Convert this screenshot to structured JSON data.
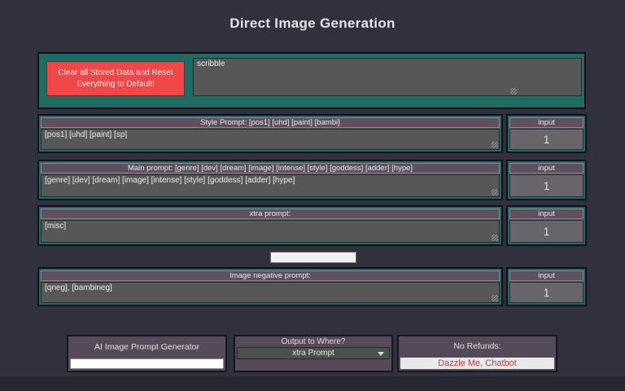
{
  "page": {
    "title": "Direct Image Generation"
  },
  "colors": {
    "background": "#31313e",
    "panel_teal": "#226b63",
    "reset_red": "#f04848",
    "label_purple": "#5d5160",
    "footer_purple": "#554a57",
    "field_gray": "#575757",
    "link_red": "#c03a3a"
  },
  "reset": {
    "button_label": "Clear all Stored Data and Reset Everything to Default!",
    "scribble_value": "scribble"
  },
  "rows": [
    {
      "label": "Style Prompt: [pos1] [uhd] [paint] [bambi]",
      "value": "[pos1] [uhd] [paint] [sp]",
      "input_label": "input",
      "input_value": "1"
    },
    {
      "label": "Main prompt: [genre] [dev] [dream] [image] [intense] [style] [goddess] [adder] [hype]",
      "value": "[genre] [dev] [dream] [image] [intense] [style] [goddess] [adder] [hype]",
      "input_label": "input",
      "input_value": "1"
    },
    {
      "label": "xtra prompt:",
      "value": "[misc]",
      "input_label": "input",
      "input_value": "1"
    },
    {
      "label": "Image negative prompt:",
      "value": "[qneg], [bambineg]",
      "input_label": "input",
      "input_value": "1"
    }
  ],
  "blank_button": {
    "label": ""
  },
  "footer": {
    "generator": {
      "title": "AI Image Prompt Generator",
      "input_value": ""
    },
    "output": {
      "title": "Output to Where?",
      "selected_option": "xtra Prompt"
    },
    "refunds": {
      "title": "No Refunds:",
      "action_label": "Dazzle Me, Chatbot"
    }
  }
}
